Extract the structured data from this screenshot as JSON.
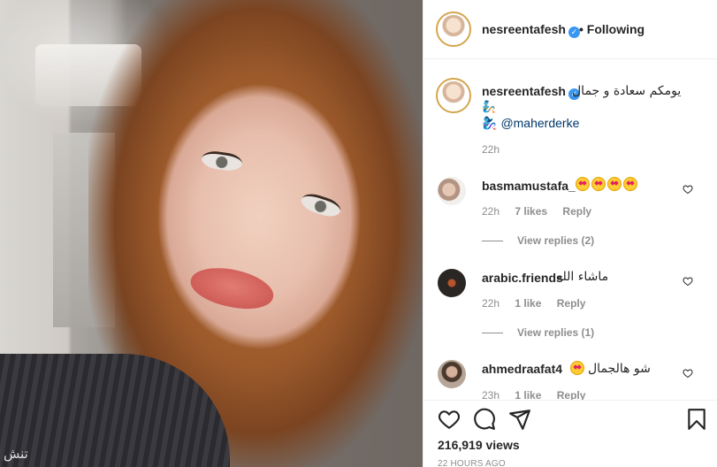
{
  "media": {
    "watermark": "تنش"
  },
  "header": {
    "username": "nesreentafesh",
    "verified_glyph": "✓",
    "follow_status": "• Following"
  },
  "caption": {
    "username": "nesreentafesh",
    "text": "يومكم سعادة و جمال",
    "emoji_line": "🧞",
    "mention": "@maherderke",
    "mention_icon": "🧞‍♀️",
    "time": "22h"
  },
  "comments": [
    {
      "username": "basmamustafa_",
      "text": "",
      "emoji_count": 4,
      "time": "22h",
      "likes": "7 likes",
      "reply": "Reply",
      "view_replies": "View replies (2)"
    },
    {
      "username": "arabic.friends",
      "text": "ماشاء الله",
      "time": "22h",
      "likes": "1 like",
      "reply": "Reply",
      "view_replies": "View replies (1)"
    },
    {
      "username": "ahmedraafat4",
      "text": "شو هالجمال",
      "emoji_count": 1,
      "time": "23h",
      "likes": "1 like",
      "reply": "Reply"
    }
  ],
  "actions": {
    "icons": [
      "heart-icon",
      "comment-icon",
      "share-icon",
      "bookmark-icon"
    ],
    "views": "216,919 views",
    "posted_ago": "22 HOURS AGO"
  },
  "colors": {
    "link": "#00376b",
    "muted": "#8e8e8e",
    "verified": "#3897f0",
    "border": "#efefef"
  }
}
